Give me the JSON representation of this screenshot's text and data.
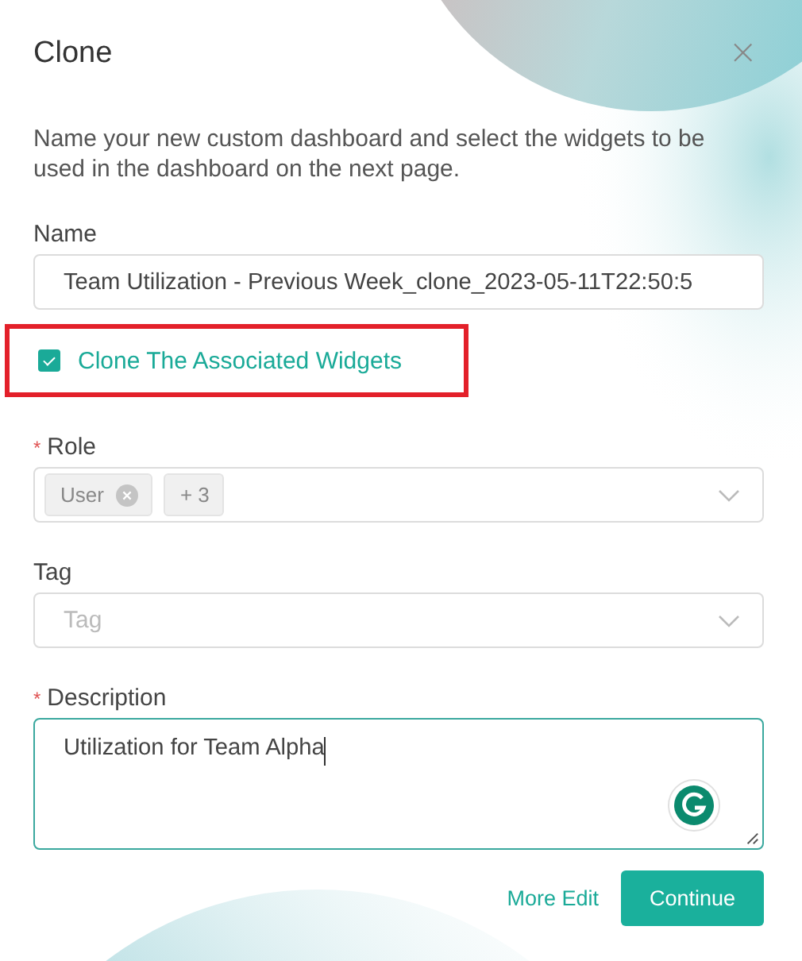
{
  "dialog": {
    "title": "Clone",
    "close": "×",
    "intro": "Name your new custom dashboard and select the widgets to be used in the dashboard on the next page."
  },
  "fields": [
    {
      "kind": "text",
      "label": "Name",
      "value": "Team Utilization - Previous Week_clone_2023-05-11T22:50:5"
    },
    {
      "kind": "checkbox",
      "label": "Clone The Associated Widgets",
      "checked": true,
      "highlighted": true
    },
    {
      "kind": "select",
      "label": "Role",
      "required_mark": "*",
      "tags": [
        {
          "label": "User",
          "removable": true
        },
        {
          "label": "+ 3",
          "removable": false
        }
      ]
    },
    {
      "kind": "select",
      "label": "Tag",
      "placeholder": "Tag"
    },
    {
      "kind": "textarea",
      "label": "Description",
      "required_mark": "*",
      "value": "Utilization for Team Alpha",
      "focused": true
    }
  ],
  "actions": [
    {
      "kind": "link",
      "label": "More Edit"
    },
    {
      "kind": "primary",
      "label": "Continue"
    }
  ]
}
